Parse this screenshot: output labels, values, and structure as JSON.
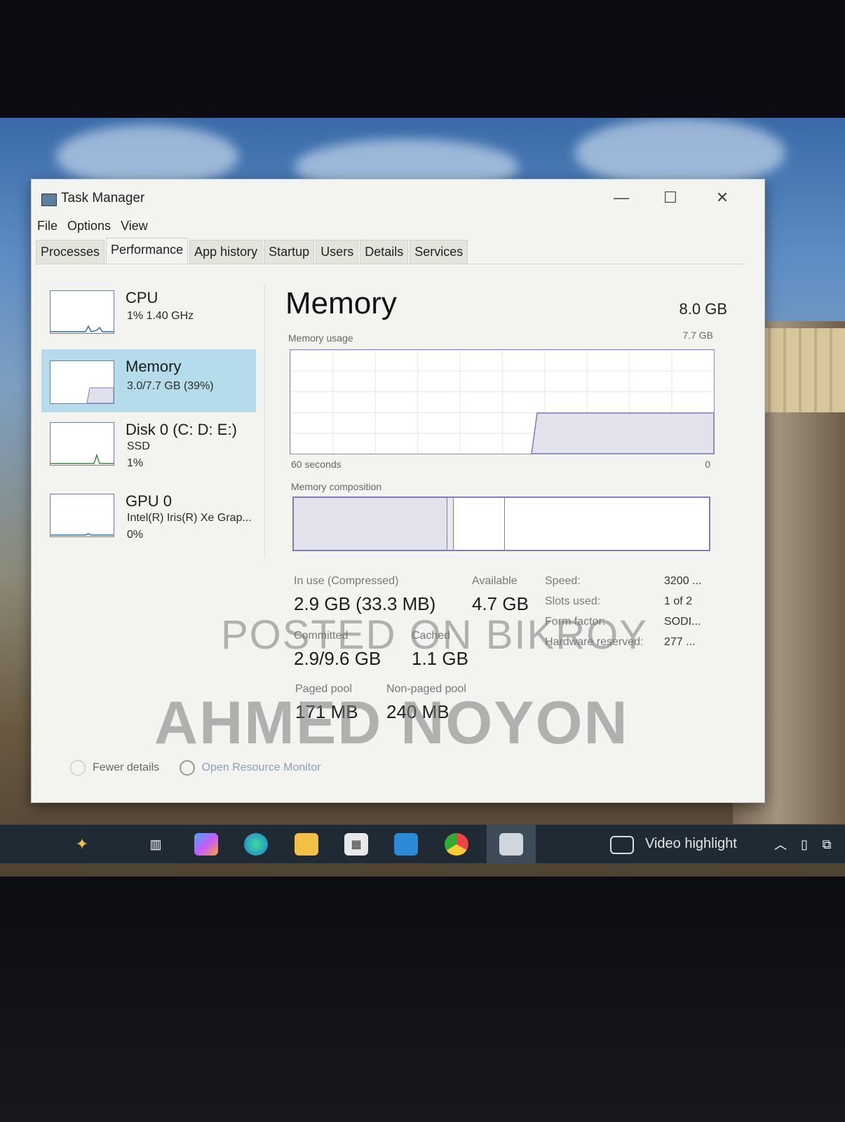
{
  "window": {
    "title": "Task Manager",
    "minimize_glyph": "—",
    "maximize_glyph": "☐",
    "close_glyph": "✕"
  },
  "menu": [
    "File",
    "Options",
    "View"
  ],
  "tabs": [
    {
      "label": "Processes"
    },
    {
      "label": "Performance",
      "active": true
    },
    {
      "label": "App history"
    },
    {
      "label": "Startup"
    },
    {
      "label": "Users"
    },
    {
      "label": "Details"
    },
    {
      "label": "Services"
    }
  ],
  "resources": {
    "cpu": {
      "name": "CPU",
      "line1": "1%  1.40 GHz"
    },
    "memory": {
      "name": "Memory",
      "line1": "3.0/7.7 GB (39%)"
    },
    "disk": {
      "name": "Disk 0 (C: D: E:)",
      "line1": "SSD",
      "line2": "1%"
    },
    "gpu": {
      "name": "GPU 0",
      "line1": "Intel(R) Iris(R) Xe Grap...",
      "line2": "0%"
    }
  },
  "detail": {
    "title": "Memory",
    "total": "8.0 GB",
    "usage_label": "Memory usage",
    "usage_max": "7.7 GB",
    "time_left": "60 seconds",
    "time_right": "0",
    "composition_label": "Memory composition",
    "stats": {
      "in_use_label": "In use (Compressed)",
      "in_use_value": "2.9 GB (33.3 MB)",
      "available_label": "Available",
      "available_value": "4.7 GB",
      "committed_label": "Committed",
      "committed_value": "2.9/9.6 GB",
      "cached_label": "Cached",
      "cached_value": "1.1 GB",
      "paged_label": "Paged pool",
      "paged_value": "171 MB",
      "nonpaged_label": "Non-paged pool",
      "nonpaged_value": "240 MB"
    },
    "specs": [
      {
        "label": "Speed:",
        "value": "3200 ..."
      },
      {
        "label": "Slots used:",
        "value": "1 of 2"
      },
      {
        "label": "Form factor:",
        "value": "SODI..."
      },
      {
        "label": "Hardware reserved:",
        "value": "277 ..."
      }
    ],
    "usage_fraction": 0.39
  },
  "footer": {
    "fewer_details": "Fewer details",
    "open_monitor": "Open Resource Monitor"
  },
  "watermarks": {
    "line1": "POSTED ON BIKROY",
    "line2": "AHMED NOYON"
  },
  "taskbar": {
    "icons": [
      "copilot-icon",
      "task-view-icon",
      "copilot-app-icon",
      "edge-icon",
      "file-explorer-icon",
      "store-icon",
      "outlook-icon",
      "chrome-icon",
      "task-manager-icon"
    ],
    "tray_text": "Video highlight"
  }
}
